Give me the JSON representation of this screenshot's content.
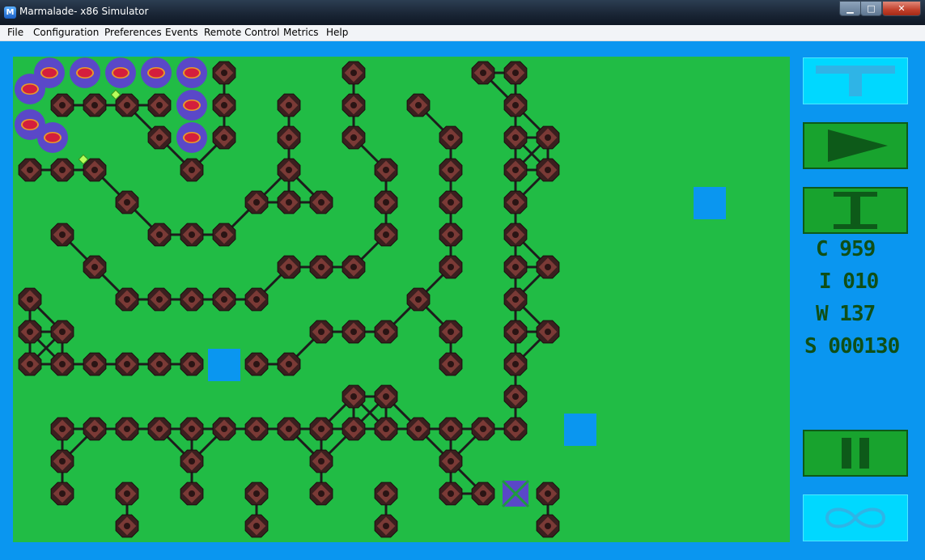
{
  "window": {
    "title": "Marmalade- x86 Simulator",
    "app_icon_letter": "M",
    "minimize_glyph": "▁",
    "maximize_glyph": "□",
    "close_glyph": "✕"
  },
  "menu": {
    "items": [
      {
        "label": "File",
        "accesskey": "F"
      },
      {
        "label": "Configuration",
        "accesskey": "C"
      },
      {
        "label": "Preferences",
        "accesskey": "P"
      },
      {
        "label": "Events"
      },
      {
        "label": "Remote Control"
      },
      {
        "label": "Metrics"
      },
      {
        "label": "Help"
      }
    ]
  },
  "colors": {
    "board": "#21bc45",
    "frame": "#0a96f0",
    "node_outer": "#3a1f1f",
    "node_inner": "#7a3a36",
    "edge": "#1c1c1c",
    "creep_outer": "#5a48c8",
    "creep_inner": "#d41e3c",
    "block": "#0a96f0",
    "button_active": "#18a32e",
    "button_inactive": "#00d8ff"
  },
  "game": {
    "stats": [
      {
        "key": "C",
        "label": "C 959"
      },
      {
        "key": "I",
        "label": "I 010"
      },
      {
        "key": "W",
        "label": "W 137"
      },
      {
        "key": "S",
        "label": "S 000130"
      }
    ],
    "sidebar_buttons": [
      {
        "name": "tower-button",
        "icon": "t-icon",
        "state": "inactive"
      },
      {
        "name": "play-button",
        "icon": "play-icon",
        "state": "active"
      },
      {
        "name": "info-button",
        "icon": "i-beam-icon",
        "state": "active"
      },
      {
        "name": "pause-button",
        "icon": "pause-icon",
        "state": "active"
      },
      {
        "name": "infinity-button",
        "icon": "infinity-icon",
        "state": "inactive"
      }
    ],
    "creep_count": 11,
    "node_count": 141,
    "blocked_tiles": 4,
    "target_marker": "x-box-icon"
  }
}
